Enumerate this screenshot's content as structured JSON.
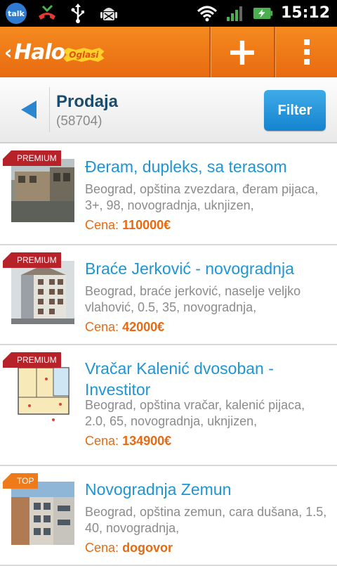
{
  "status_bar": {
    "talk_label": "talk",
    "time": "15:12",
    "icons": [
      "talk-icon",
      "missed-call-icon",
      "usb-icon",
      "android-debug-icon",
      "wifi-icon",
      "signal-icon",
      "battery-charging-icon"
    ]
  },
  "app_bar": {
    "logo_main": "Halo",
    "logo_sub": "Oglasi",
    "accent": "#f07a18"
  },
  "sub_header": {
    "title": "Prodaja",
    "count": "(58704)",
    "filter_label": "Filter"
  },
  "listings": [
    {
      "badge": "PREMIUM",
      "title": "Đeram, dupleks, sa terasom",
      "description": "Beograd, opština zvezdara, đeram pijaca, 3+, 98, novogradnja, uknjizen,",
      "price_label": "Cena:",
      "price": "110000€"
    },
    {
      "badge": "PREMIUM",
      "title": "Braće Jerković - novogradnja",
      "description": "Beograd, braće jerković, naselje veljko vlahović, 0.5, 35, novogradnja,",
      "price_label": "Cena:",
      "price": "42000€"
    },
    {
      "badge": "PREMIUM",
      "title": "Vračar Kalenić dvosoban - Investitor",
      "description": "Beograd, opština vračar, kalenić pijaca, 2.0, 65, novogradnja, uknjizen,",
      "price_label": "Cena:",
      "price": "134900€"
    },
    {
      "badge": "TOP",
      "title": "Novogradnja Zemun",
      "description": "Beograd, opština zemun, cara dušana, 1.5, 40, novogradnja,",
      "price_label": "Cena:",
      "price": "dogovor"
    }
  ]
}
